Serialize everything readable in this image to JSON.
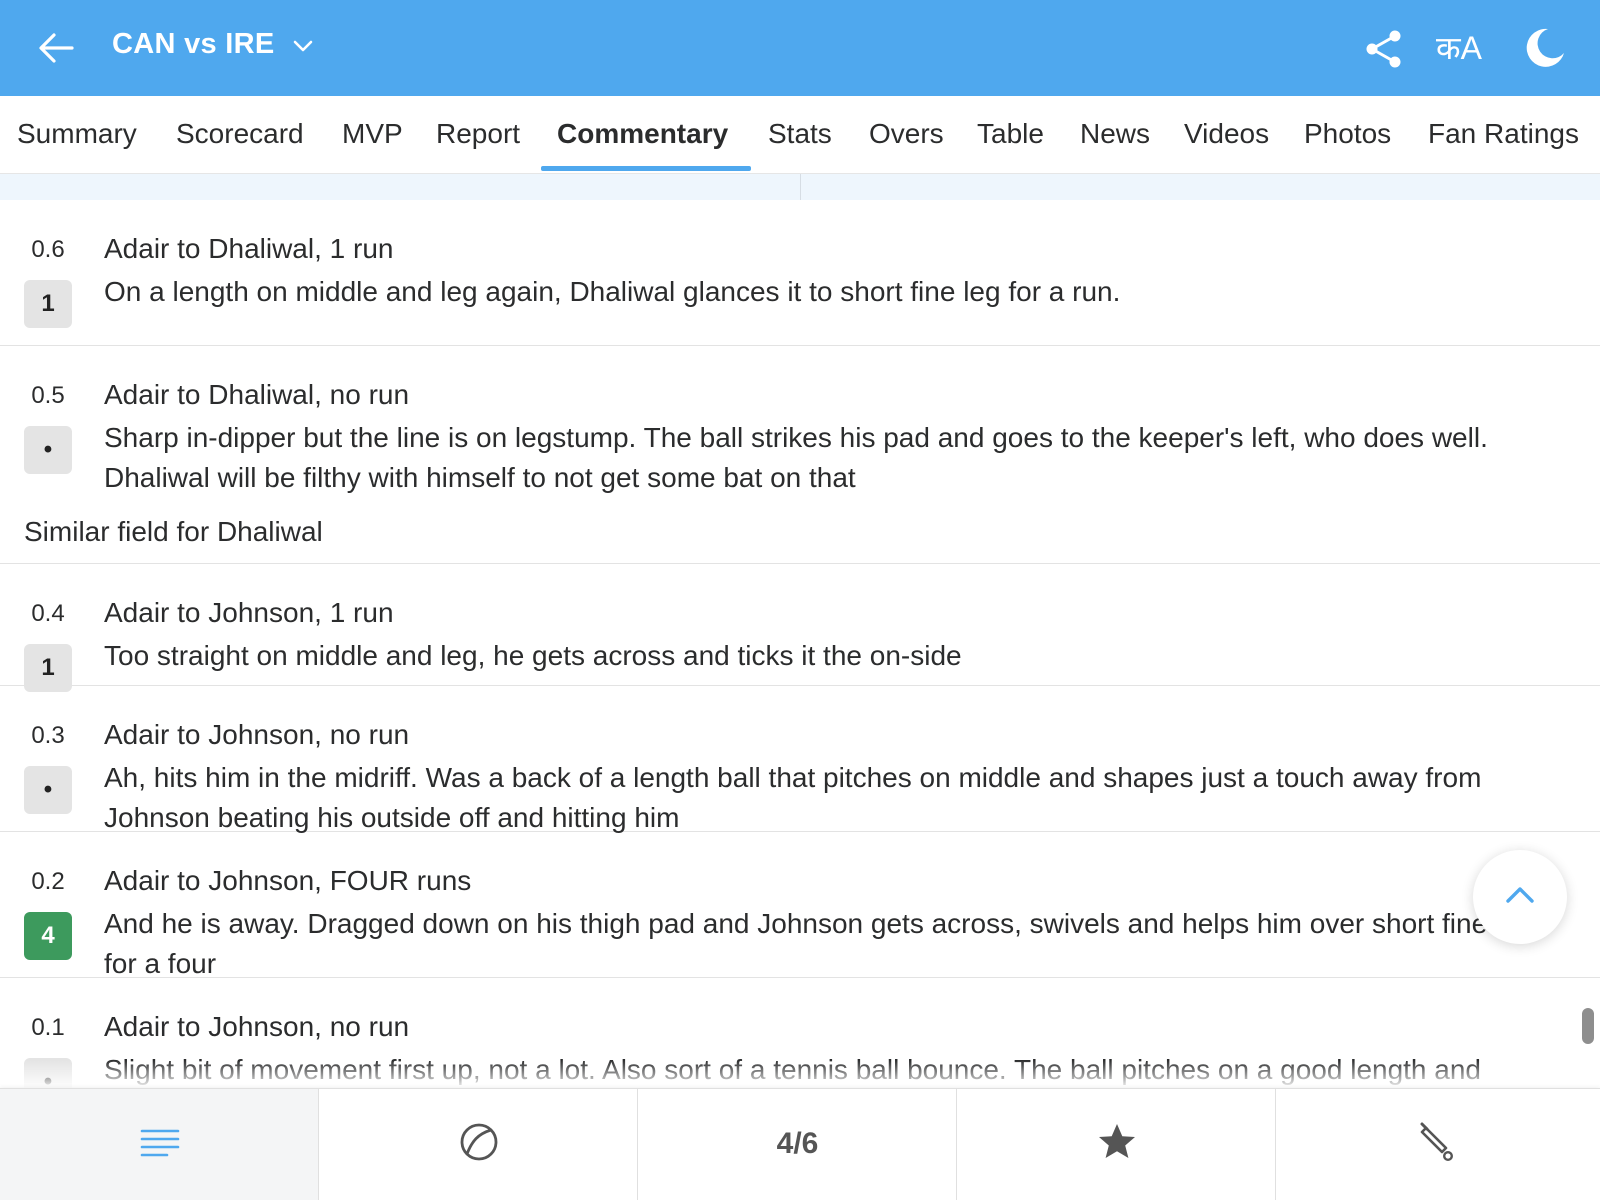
{
  "header": {
    "match_title": "CAN vs IRE",
    "lang_label": "कA",
    "icons": [
      "back-arrow-icon",
      "chevron-down-icon",
      "share-icon",
      "language-icon",
      "moon-icon"
    ]
  },
  "tabs": [
    {
      "label": "Summary"
    },
    {
      "label": "Scorecard"
    },
    {
      "label": "MVP"
    },
    {
      "label": "Report"
    },
    {
      "label": "Commentary",
      "active": true
    },
    {
      "label": "Stats"
    },
    {
      "label": "Overs"
    },
    {
      "label": "Table"
    },
    {
      "label": "News"
    },
    {
      "label": "Videos"
    },
    {
      "label": "Photos"
    },
    {
      "label": "Fan Ratings"
    }
  ],
  "commentary": {
    "balls": [
      {
        "over": "0.6",
        "result": "1",
        "headline": "Adair to Dhaliwal, 1 run",
        "text": "On a length on middle and leg again, Dhaliwal glances it to short fine leg for a run."
      },
      {
        "over": "0.5",
        "result": "•",
        "headline": "Adair to Dhaliwal, no run",
        "text": "Sharp in-dipper but the line is on legstump. The ball strikes his pad and goes to the keeper's left, who does well. Dhaliwal will be filthy with himself to not get some bat on that"
      },
      {
        "over": "0.4",
        "result": "1",
        "headline": "Adair to Johnson, 1 run",
        "text": "Too straight on middle and leg, he gets across and ticks it the on-side"
      },
      {
        "over": "0.3",
        "result": "•",
        "headline": "Adair to Johnson, no run",
        "text": "Ah, hits him in the midriff. Was a back of a length ball that pitches on middle and shapes just a touch away from Johnson beating his outside off and hitting him"
      },
      {
        "over": "0.2",
        "result": "4",
        "headline": "Adair to Johnson, FOUR runs",
        "text": "And he is away. Dragged down on his thigh pad and Johnson gets across, swivels and helps him over short fine leg for a four"
      },
      {
        "over": "0.1",
        "result": "•",
        "headline": "Adair to Johnson, no run",
        "text": "Slight bit of movement first up, not a lot. Also sort of a tennis ball bounce. The ball pitches on a good length and shapes away from Johnson who feels for it outside off"
      }
    ],
    "note": "Similar field for Dhaliwal"
  },
  "bottom_bar": {
    "page_indicator": "4/6",
    "icons": [
      "menu-lines-icon",
      "ball-icon",
      "star-icon",
      "bat-icon"
    ]
  },
  "colors": {
    "accent": "#4fa8ee",
    "four_badge": "#3d9a5d",
    "badge_gray": "#e4e4e4",
    "strip": "#eef6fd"
  }
}
